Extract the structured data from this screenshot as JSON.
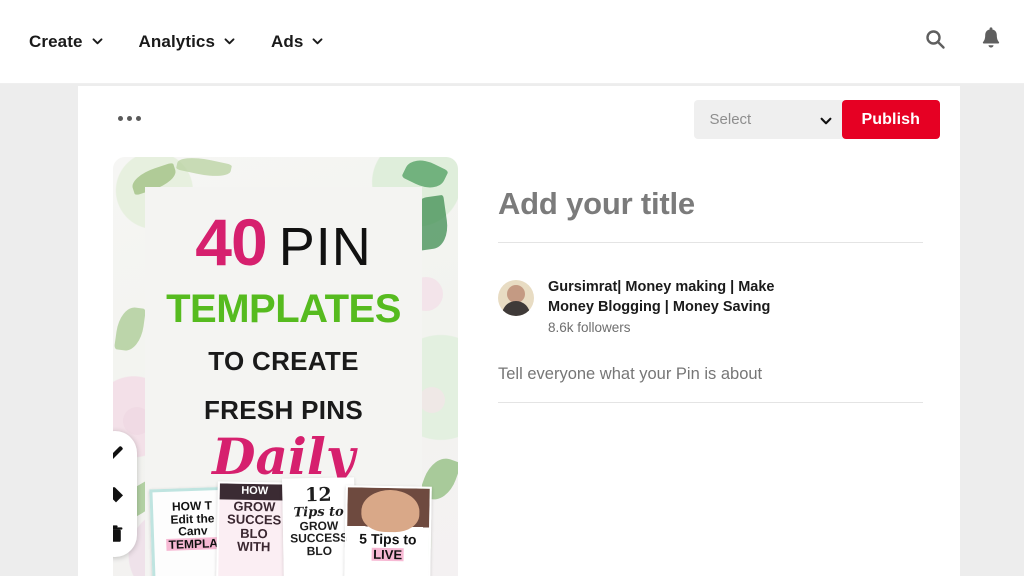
{
  "nav": {
    "items": [
      {
        "label": "Create",
        "icon": "chevron-down-icon"
      },
      {
        "label": "Analytics",
        "icon": "chevron-down-icon"
      },
      {
        "label": "Ads",
        "icon": "chevron-down-icon"
      }
    ],
    "search_icon": "search-icon",
    "notifications_icon": "bell-icon"
  },
  "toolbar": {
    "overflow_icon": "more-options-icon",
    "select_value": "Select",
    "select_chevron": "chevron-down-icon",
    "publish_label": "Publish"
  },
  "pin_tools": [
    {
      "name": "edit-icon",
      "title": "Edit"
    },
    {
      "name": "tag-icon",
      "title": "Tag"
    },
    {
      "name": "delete-icon",
      "title": "Delete"
    }
  ],
  "pin_graphic": {
    "number": "40",
    "word": "PIN",
    "templates": "TEMPLATES",
    "line1": "TO CREATE",
    "line2": "FRESH PINS",
    "script": "Daily",
    "colors": {
      "magenta": "#d6206e",
      "green": "#56bb1f",
      "black": "#111111"
    },
    "thumbnails": [
      {
        "line1": "HOW T",
        "line2": "Edit the",
        "line3": "Canv",
        "line4": "TEMPLA"
      },
      {
        "line1": "HOW",
        "line2": "GROW",
        "line3": "SUCCES",
        "line4": "BLO",
        "line5": "WITH"
      },
      {
        "line1": "12",
        "line2": "Tips to",
        "line3": "GROW",
        "line4": "SUCCESS",
        "line5": "BLO"
      },
      {
        "line1": "5 Tips to",
        "line2": "LIVE"
      }
    ]
  },
  "details": {
    "title_placeholder": "Add your title",
    "author_name": "Gursimrat| Money making | Make Money Blogging | Money Saving",
    "author_followers": "8.6k followers",
    "description_placeholder": "Tell everyone what your Pin is about",
    "avatar_icon": "avatar"
  },
  "colors": {
    "brand_red": "#e60023",
    "page_background": "#ededed",
    "card_background": "#ffffff"
  }
}
